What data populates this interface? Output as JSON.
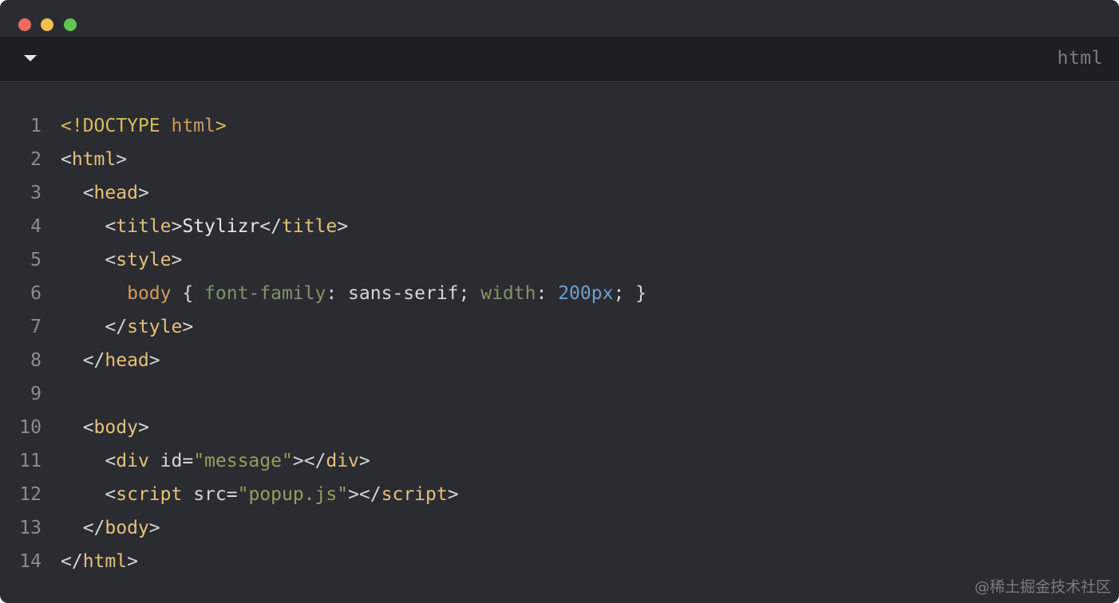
{
  "window": {
    "traffic_lights": [
      {
        "name": "close",
        "color": "#ed6a5e"
      },
      {
        "name": "minimize",
        "color": "#f5bf4f"
      },
      {
        "name": "zoom",
        "color": "#61c554"
      }
    ]
  },
  "toolbar": {
    "collapse_icon": "caret-down-icon",
    "language": "html"
  },
  "colors": {
    "punct": "#d6d6d6",
    "tag": "#e5c07b",
    "doctype": "#d9b95c",
    "attrname": "#d6d6d6",
    "string": "#8fa05f",
    "selector": "#d19a5a",
    "property": "#7f9467",
    "number": "#6f9fcf",
    "text": "#e8e8e8"
  },
  "lines": [
    {
      "n": "1",
      "tokens": [
        [
          "doctype",
          "<!DOCTYPE "
        ],
        [
          "selector",
          "html"
        ],
        [
          "doctype",
          ">"
        ]
      ]
    },
    {
      "n": "2",
      "tokens": [
        [
          "punct",
          "<"
        ],
        [
          "tag",
          "html"
        ],
        [
          "punct",
          ">"
        ]
      ]
    },
    {
      "n": "3",
      "tokens": [
        [
          "punct",
          "  <"
        ],
        [
          "tag",
          "head"
        ],
        [
          "punct",
          ">"
        ]
      ]
    },
    {
      "n": "4",
      "tokens": [
        [
          "punct",
          "    <"
        ],
        [
          "tag",
          "title"
        ],
        [
          "punct",
          ">"
        ],
        [
          "text",
          "Stylizr"
        ],
        [
          "punct",
          "</"
        ],
        [
          "tag",
          "title"
        ],
        [
          "punct",
          ">"
        ]
      ]
    },
    {
      "n": "5",
      "tokens": [
        [
          "punct",
          "    <"
        ],
        [
          "tag",
          "style"
        ],
        [
          "punct",
          ">"
        ]
      ]
    },
    {
      "n": "6",
      "tokens": [
        [
          "punct",
          "      "
        ],
        [
          "selector",
          "body"
        ],
        [
          "punct",
          " { "
        ],
        [
          "property",
          "font-family"
        ],
        [
          "punct",
          ": sans-serif; "
        ],
        [
          "property",
          "width"
        ],
        [
          "punct",
          ": "
        ],
        [
          "number",
          "200px"
        ],
        [
          "punct",
          "; }"
        ]
      ]
    },
    {
      "n": "7",
      "tokens": [
        [
          "punct",
          "    </"
        ],
        [
          "tag",
          "style"
        ],
        [
          "punct",
          ">"
        ]
      ]
    },
    {
      "n": "8",
      "tokens": [
        [
          "punct",
          "  </"
        ],
        [
          "tag",
          "head"
        ],
        [
          "punct",
          ">"
        ]
      ]
    },
    {
      "n": "9",
      "tokens": []
    },
    {
      "n": "10",
      "tokens": [
        [
          "punct",
          "  <"
        ],
        [
          "tag",
          "body"
        ],
        [
          "punct",
          ">"
        ]
      ]
    },
    {
      "n": "11",
      "tokens": [
        [
          "punct",
          "    <"
        ],
        [
          "tag",
          "div"
        ],
        [
          "attrname",
          " id="
        ],
        [
          "string",
          "\"message\""
        ],
        [
          "punct",
          "></"
        ],
        [
          "tag",
          "div"
        ],
        [
          "punct",
          ">"
        ]
      ]
    },
    {
      "n": "12",
      "tokens": [
        [
          "punct",
          "    <"
        ],
        [
          "tag",
          "script"
        ],
        [
          "attrname",
          " src="
        ],
        [
          "string",
          "\"popup.js\""
        ],
        [
          "punct",
          "></"
        ],
        [
          "tag",
          "script"
        ],
        [
          "punct",
          ">"
        ]
      ]
    },
    {
      "n": "13",
      "tokens": [
        [
          "punct",
          "  </"
        ],
        [
          "tag",
          "body"
        ],
        [
          "punct",
          ">"
        ]
      ]
    },
    {
      "n": "14",
      "tokens": [
        [
          "punct",
          "</"
        ],
        [
          "tag",
          "html"
        ],
        [
          "punct",
          ">"
        ]
      ]
    }
  ],
  "watermark": "@稀土掘金技术社区"
}
